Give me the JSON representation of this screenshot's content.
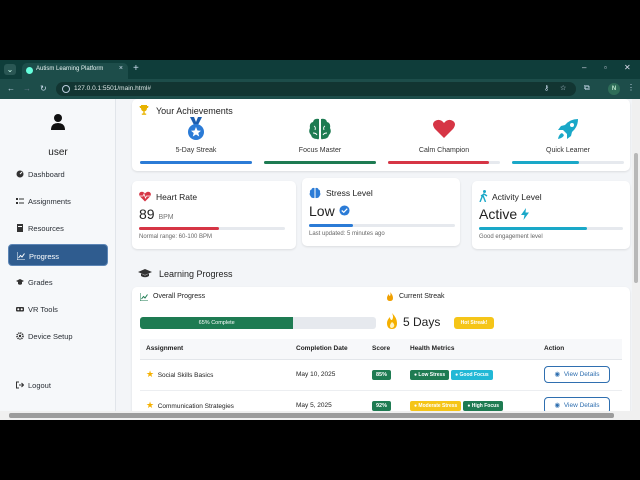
{
  "browser": {
    "tab_title": "Autism Learning Platform",
    "url": "127.0.0.1:5501/main.html#",
    "profile_initial": "N"
  },
  "sidebar": {
    "user": "user",
    "items": [
      {
        "label": "Dashboard",
        "icon": "gauge-icon",
        "active": false
      },
      {
        "label": "Assignments",
        "icon": "tasks-icon",
        "active": false
      },
      {
        "label": "Resources",
        "icon": "book-icon",
        "active": false
      },
      {
        "label": "Progress",
        "icon": "chart-icon",
        "active": true
      },
      {
        "label": "Grades",
        "icon": "graduation-cap-icon",
        "active": false
      },
      {
        "label": "VR Tools",
        "icon": "vr-headset-icon",
        "active": false
      },
      {
        "label": "Device Setup",
        "icon": "gear-icon",
        "active": false
      }
    ],
    "logout": "Logout"
  },
  "achievements": {
    "title": "Your Achievements",
    "items": [
      {
        "label": "5-Day Streak",
        "icon": "medal-icon",
        "color": "#2b7bd6",
        "progress": 1.0
      },
      {
        "label": "Focus Master",
        "icon": "brain-icon",
        "color": "#1e7b52",
        "progress": 1.0
      },
      {
        "label": "Calm Champion",
        "icon": "heart-icon",
        "color": "#d63545",
        "progress": 0.9
      },
      {
        "label": "Quick Learner",
        "icon": "rocket-icon",
        "color": "#1aa8c8",
        "progress": 0.6
      }
    ]
  },
  "metrics": {
    "heart": {
      "title": "Heart Rate",
      "value": "89",
      "unit": "BPM",
      "sub": "Normal range: 60-100 BPM",
      "color": "#d63545",
      "progress": 0.55
    },
    "stress": {
      "title": "Stress Level",
      "value": "Low",
      "sub": "Last updated: 5 minutes ago",
      "color": "#2b7bd6",
      "progress": 0.3
    },
    "activity": {
      "title": "Activity Level",
      "value": "Active",
      "sub": "Good engagement level",
      "color": "#1aa8c8",
      "progress": 0.75
    }
  },
  "learning": {
    "title": "Learning Progress",
    "overall_label": "Overall Progress",
    "overall_text": "65% Complete",
    "overall_value": 0.65,
    "streak_label": "Current Streak",
    "streak_value": "5 Days",
    "streak_badge": "Hot Streak!",
    "columns": [
      "Assignment",
      "Completion Date",
      "Score",
      "Health Metrics",
      "Action"
    ],
    "rows": [
      {
        "name": "Social Skills Basics",
        "date": "May 10, 2025",
        "score": "85%",
        "tags": [
          {
            "text": "Low Stress",
            "color": "#1e7b52"
          },
          {
            "text": "Good Focus",
            "color": "#22b8d6"
          }
        ],
        "action": "View Details"
      },
      {
        "name": "Communication Strategies",
        "date": "May 5, 2025",
        "score": "92%",
        "tags": [
          {
            "text": "Moderate Stress",
            "color": "#f5c518"
          },
          {
            "text": "High Focus",
            "color": "#1e7b52"
          }
        ],
        "action": "View Details"
      }
    ]
  }
}
